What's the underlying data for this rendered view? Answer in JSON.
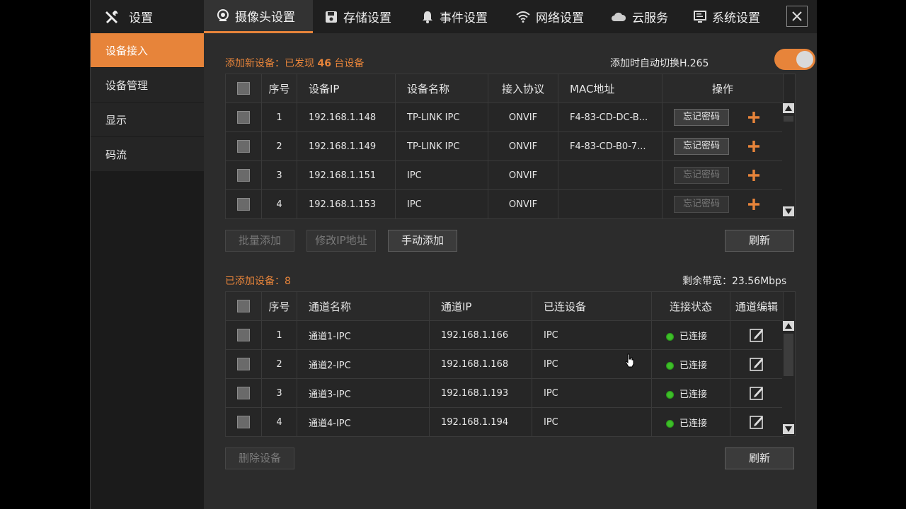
{
  "brand": {
    "title": "设置"
  },
  "tabs": [
    {
      "label": "摄像头设置",
      "active": true
    },
    {
      "label": "存储设置"
    },
    {
      "label": "事件设置"
    },
    {
      "label": "网络设置"
    },
    {
      "label": "云服务"
    },
    {
      "label": "系统设置"
    }
  ],
  "sidebar": {
    "items": [
      {
        "label": "设备接入",
        "active": true
      },
      {
        "label": "设备管理"
      },
      {
        "label": "显示"
      },
      {
        "label": "码流"
      }
    ]
  },
  "discover": {
    "title_prefix": "添加新设备：已发现",
    "count": "46",
    "title_suffix": "台设备",
    "auto_switch_label": "添加时自动切换H.265",
    "auto_switch_on": true,
    "columns": [
      "序号",
      "设备IP",
      "设备名称",
      "接入协议",
      "MAC地址",
      "操作"
    ],
    "rows": [
      {
        "no": "1",
        "ip": "192.168.1.148",
        "name": "TP-LINK IPC",
        "protocol": "ONVIF",
        "mac": "F4-83-CD-DC-B...",
        "forgot": "忘记密码",
        "forgot_enabled": true
      },
      {
        "no": "2",
        "ip": "192.168.1.149",
        "name": "TP-LINK IPC",
        "protocol": "ONVIF",
        "mac": "F4-83-CD-B0-7...",
        "forgot": "忘记密码",
        "forgot_enabled": true
      },
      {
        "no": "3",
        "ip": "192.168.1.151",
        "name": "IPC",
        "protocol": "ONVIF",
        "mac": "",
        "forgot": "忘记密码",
        "forgot_enabled": false
      },
      {
        "no": "4",
        "ip": "192.168.1.153",
        "name": "IPC",
        "protocol": "ONVIF",
        "mac": "",
        "forgot": "忘记密码",
        "forgot_enabled": false
      }
    ],
    "buttons": {
      "batch_add": "批量添加",
      "modify_ip": "修改IP地址",
      "manual_add": "手动添加",
      "refresh": "刷新"
    }
  },
  "added": {
    "title": "已添加设备：8",
    "bandwidth": "剩余带宽：23.56Mbps",
    "columns": [
      "序号",
      "通道名称",
      "通道IP",
      "已连设备",
      "连接状态",
      "通道编辑"
    ],
    "rows": [
      {
        "no": "1",
        "channel": "通道1-IPC",
        "ip": "192.168.1.166",
        "device": "IPC",
        "status": "已连接"
      },
      {
        "no": "2",
        "channel": "通道2-IPC",
        "ip": "192.168.1.168",
        "device": "IPC",
        "status": "已连接"
      },
      {
        "no": "3",
        "channel": "通道3-IPC",
        "ip": "192.168.1.193",
        "device": "IPC",
        "status": "已连接"
      },
      {
        "no": "4",
        "channel": "通道4-IPC",
        "ip": "192.168.1.194",
        "device": "IPC",
        "status": "已连接"
      }
    ],
    "buttons": {
      "delete": "删除设备",
      "refresh": "刷新"
    }
  },
  "colors": {
    "accent": "#e7843a",
    "connected": "#3fbf2a"
  },
  "icons": [
    "tools-icon",
    "camera-icon",
    "save-icon",
    "bell-icon",
    "wifi-icon",
    "cloud-icon",
    "monitor-icon",
    "close-icon",
    "plus-icon",
    "edit-icon"
  ]
}
